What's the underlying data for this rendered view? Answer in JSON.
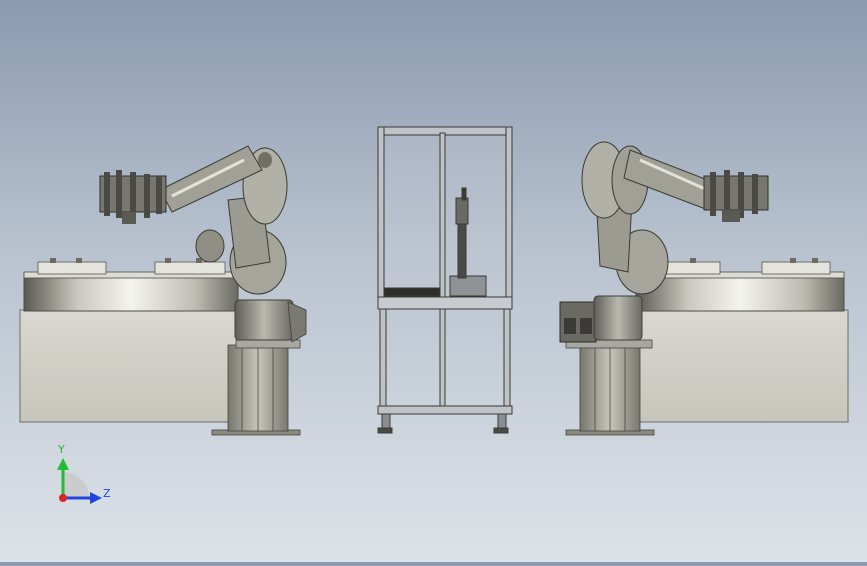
{
  "scene": {
    "description_colors": {
      "background_top": "#8b9ab0",
      "background_bottom": "#dde2e8",
      "metal_light": "#e8e8e0",
      "metal_dark": "#6f6f66",
      "robot_body": "#9a9a90",
      "cabinet": "#cfcfc6",
      "frame": "#b8bcc0"
    }
  },
  "triad": {
    "y_label": "Y",
    "z_label": "Z",
    "y_color": "#22bb33",
    "z_color": "#2244dd",
    "origin_color": "#dd2222"
  }
}
